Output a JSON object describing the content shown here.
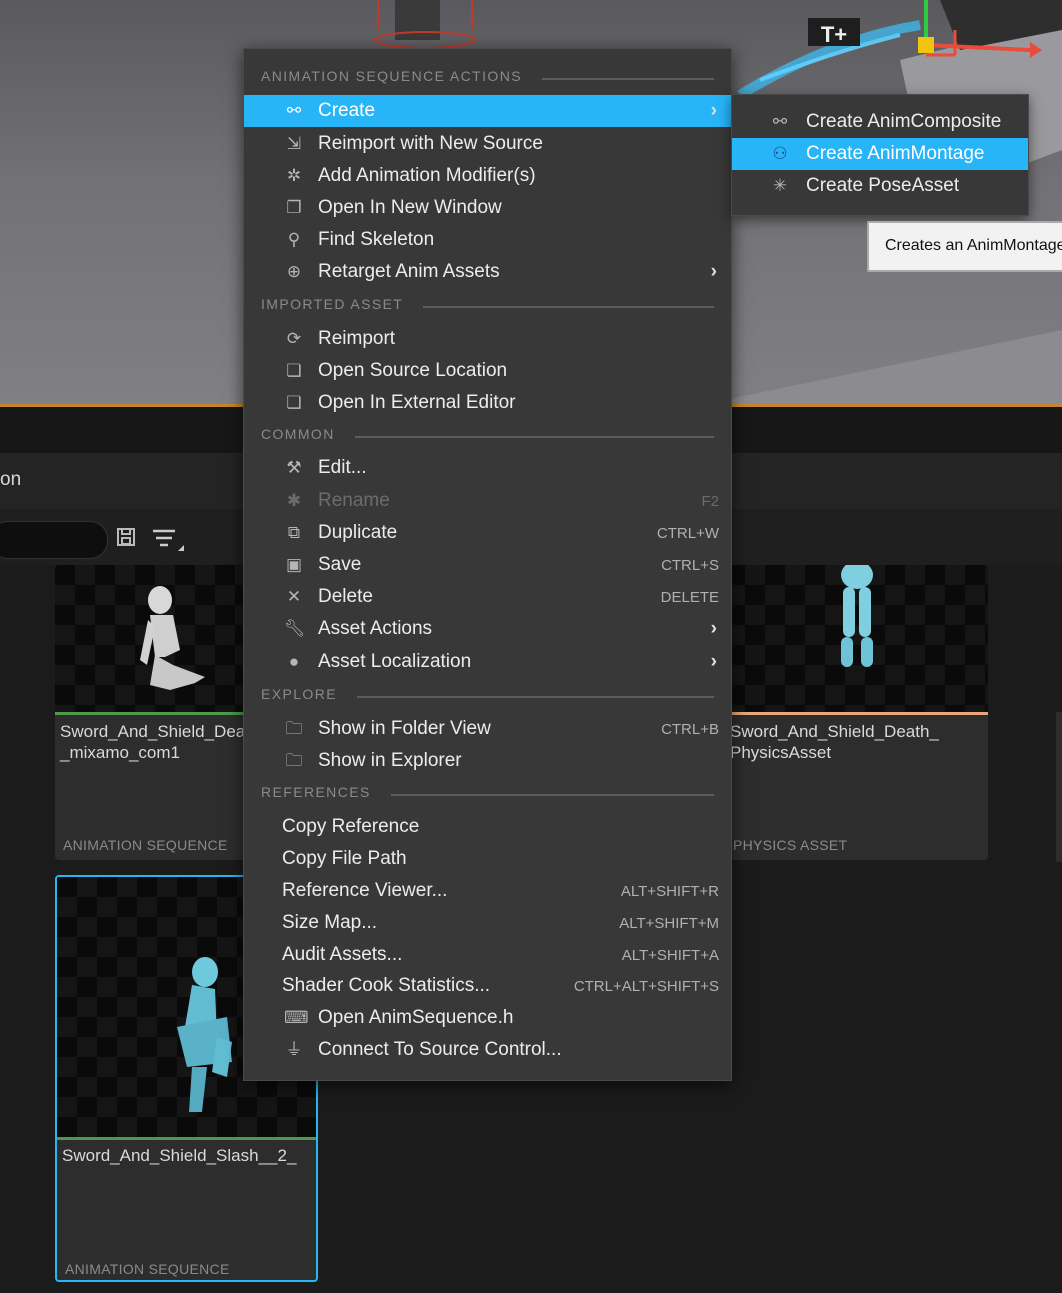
{
  "viewport": {
    "gizmo_label": "T+"
  },
  "content_browser": {
    "partial_title": "on",
    "assets": [
      {
        "name": "Sword_And_Shield_Dea\n_mixamo_com1",
        "type": "ANIMATION SEQUENCE"
      },
      {
        "name": "Sword_And_Shield_Death_\nPhysicsAsset",
        "type": "PHYSICS ASSET"
      },
      {
        "name": "Sword_And_Shield_Slash__2_",
        "type": "ANIMATION SEQUENCE"
      }
    ]
  },
  "context_menu": {
    "sections": {
      "anim_actions": "ANIMATION SEQUENCE ACTIONS",
      "imported": "IMPORTED ASSET",
      "common": "COMMON",
      "explore": "EXPLORE",
      "references": "REFERENCES"
    },
    "items": {
      "create": {
        "label": "Create",
        "icon": "create-anim-icon"
      },
      "reimport_new_source": {
        "label": "Reimport with New Source",
        "icon": "reimport-arrow-icon"
      },
      "add_modifier": {
        "label": "Add Animation Modifier(s)",
        "icon": "modifier-icon"
      },
      "open_new_window": {
        "label": "Open In New Window",
        "icon": "window-icon"
      },
      "find_skeleton": {
        "label": "Find Skeleton",
        "icon": "magnifier-icon"
      },
      "retarget": {
        "label": "Retarget Anim Assets",
        "icon": "retarget-icon"
      },
      "reimport": {
        "label": "Reimport",
        "icon": "reimport-icon"
      },
      "open_source_location": {
        "label": "Open Source Location",
        "icon": "folder-open-icon"
      },
      "open_external_editor": {
        "label": "Open In External Editor",
        "icon": "external-editor-icon"
      },
      "edit": {
        "label": "Edit...",
        "icon": "edit-hammer-icon"
      },
      "rename": {
        "label": "Rename",
        "shortcut": "F2",
        "icon": "rename-star-icon"
      },
      "duplicate": {
        "label": "Duplicate",
        "shortcut": "CTRL+W",
        "icon": "duplicate-icon"
      },
      "save": {
        "label": "Save",
        "shortcut": "CTRL+S",
        "icon": "save-floppy-icon"
      },
      "delete": {
        "label": "Delete",
        "shortcut": "DELETE",
        "icon": "delete-x-icon"
      },
      "asset_actions": {
        "label": "Asset Actions",
        "icon": "wrench-icon"
      },
      "asset_localization": {
        "label": "Asset Localization",
        "icon": "globe-icon"
      },
      "show_folder_view": {
        "label": "Show in Folder View",
        "shortcut": "CTRL+B",
        "icon": "folder-search-icon"
      },
      "show_explorer": {
        "label": "Show in Explorer",
        "icon": "folder-search-icon"
      },
      "copy_reference": {
        "label": "Copy Reference"
      },
      "copy_file_path": {
        "label": "Copy File Path"
      },
      "reference_viewer": {
        "label": "Reference Viewer...",
        "shortcut": "ALT+SHIFT+R"
      },
      "size_map": {
        "label": "Size Map...",
        "shortcut": "ALT+SHIFT+M"
      },
      "audit_assets": {
        "label": "Audit Assets...",
        "shortcut": "ALT+SHIFT+A"
      },
      "shader_cook": {
        "label": "Shader Cook Statistics...",
        "shortcut": "CTRL+ALT+SHIFT+S"
      },
      "open_header": {
        "label": "Open AnimSequence.h",
        "icon": "code-file-icon"
      },
      "connect_source_control": {
        "label": "Connect To Source Control...",
        "icon": "plug-icon"
      }
    }
  },
  "submenu": {
    "items": {
      "anim_composite": {
        "label": "Create AnimComposite",
        "icon": "anim-composite-icon"
      },
      "anim_montage": {
        "label": "Create AnimMontage",
        "icon": "anim-montage-icon"
      },
      "pose_asset": {
        "label": "Create PoseAsset",
        "icon": "pose-asset-icon"
      }
    }
  },
  "tooltip": {
    "text": "Creates an AnimMontage"
  },
  "colors": {
    "highlight": "#27b5f7",
    "menu_bg": "#383838",
    "viewport_accent": "#c9842a",
    "card_selected_border": "#27b5f7"
  }
}
